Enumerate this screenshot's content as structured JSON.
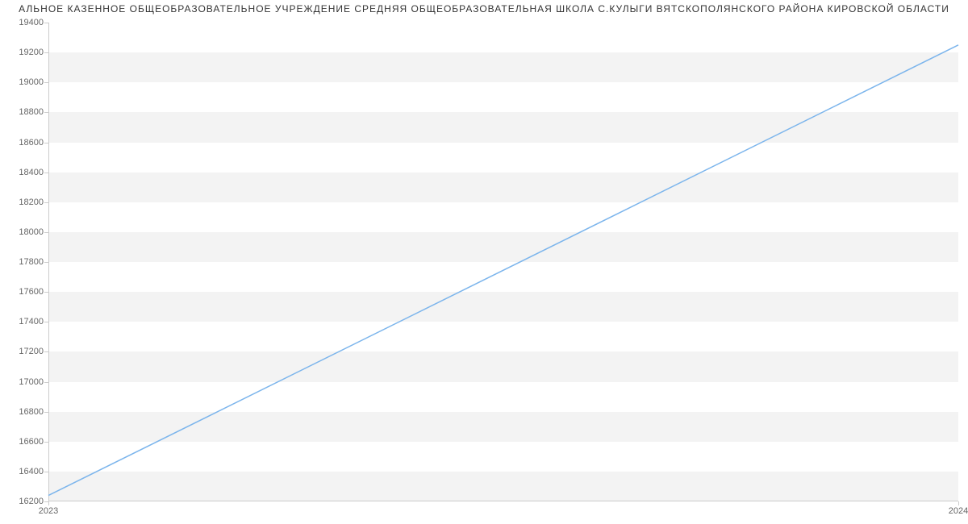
{
  "chart_data": {
    "type": "line",
    "title": "АЛЬНОЕ КАЗЕННОЕ ОБЩЕОБРАЗОВАТЕЛЬНОЕ УЧРЕЖДЕНИЕ СРЕДНЯЯ ОБЩЕОБРАЗОВАТЕЛЬНАЯ ШКОЛА С.КУЛЫГИ ВЯТСКОПОЛЯНСКОГО РАЙОНА КИРОВСКОЙ ОБЛАСТИ",
    "x": [
      2023,
      2024
    ],
    "values": [
      16240,
      19250
    ],
    "xlabel": "",
    "ylabel": "",
    "xlim": [
      2023,
      2024
    ],
    "ylim": [
      16200,
      19400
    ],
    "y_ticks": [
      16200,
      16400,
      16600,
      16800,
      17000,
      17200,
      17400,
      17600,
      17800,
      18000,
      18200,
      18400,
      18600,
      18800,
      19000,
      19200,
      19400
    ],
    "x_ticks": [
      2023,
      2024
    ],
    "colors": {
      "line": "#7cb5ec",
      "band": "#f3f3f3"
    }
  }
}
